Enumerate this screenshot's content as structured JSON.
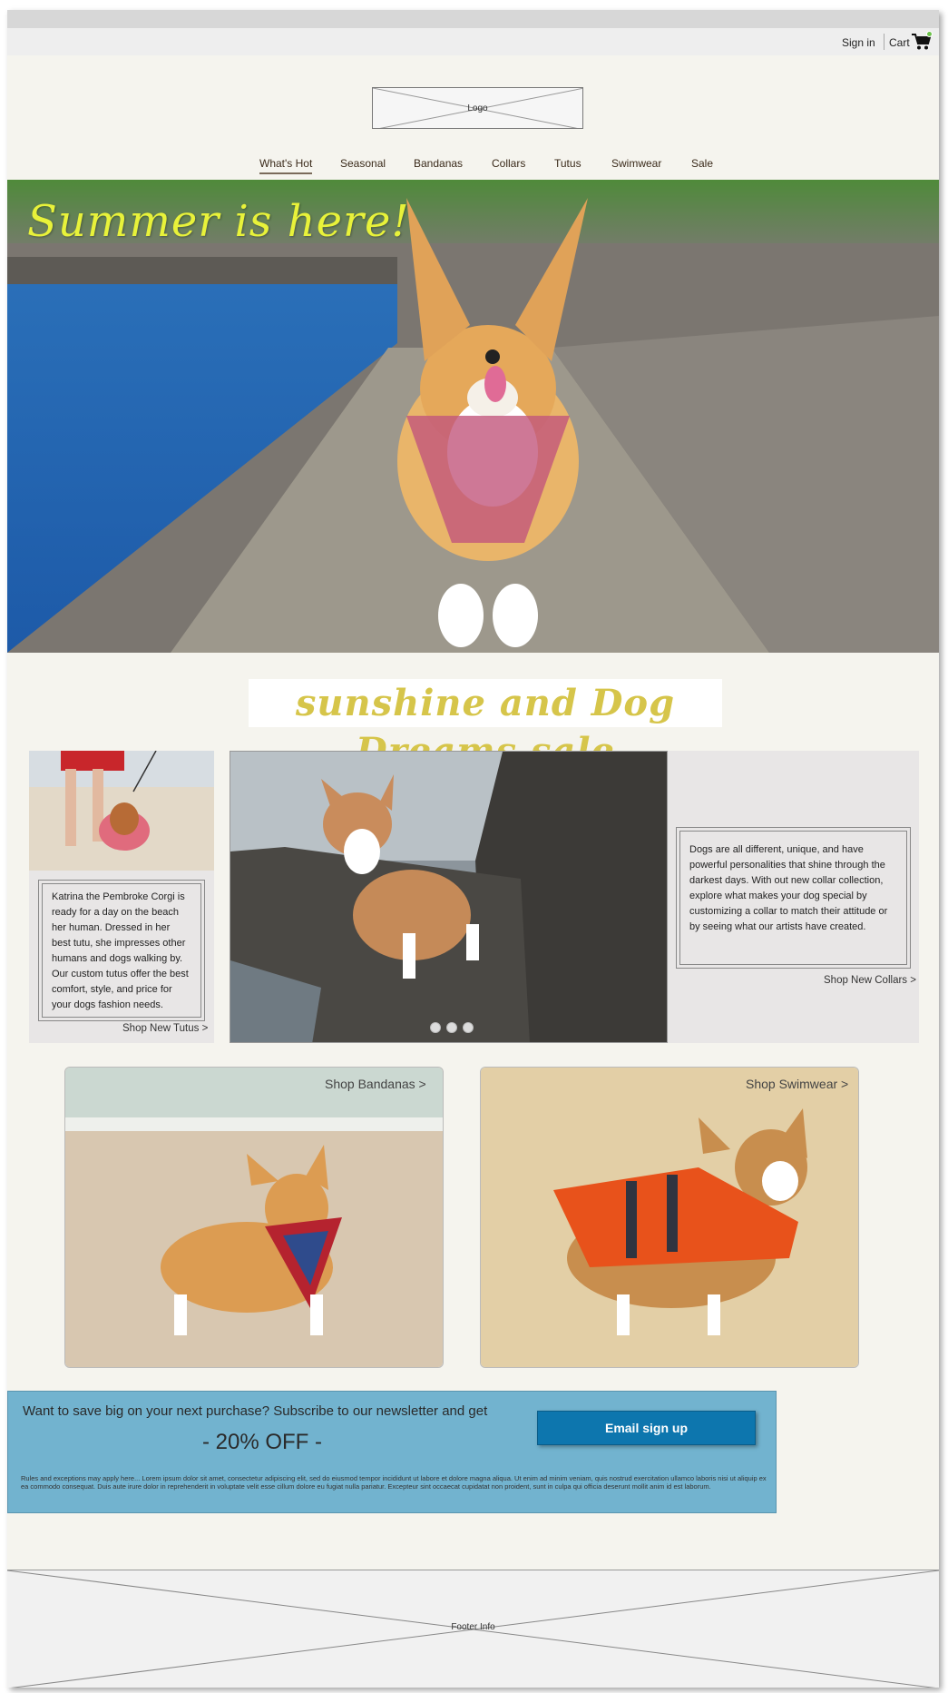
{
  "utility": {
    "signin": "Sign in",
    "cart": "Cart"
  },
  "logo": {
    "label": "Logo"
  },
  "nav": [
    {
      "label": "What's Hot",
      "active": true
    },
    {
      "label": "Seasonal"
    },
    {
      "label": "Bandanas"
    },
    {
      "label": "Collars"
    },
    {
      "label": "Tutus"
    },
    {
      "label": "Swimwear"
    },
    {
      "label": "Sale"
    }
  ],
  "hero": {
    "title": "Summer is here!"
  },
  "sale_banner": {
    "title": "sunshine and Dog Dreams sale"
  },
  "tutu_card": {
    "text": "Katrina the Pembroke Corgi is ready for a day on the beach her human. Dressed in her best tutu, she impresses other humans and dogs walking by. Our custom tutus offer the best comfort, style, and price for your dogs fashion needs.",
    "link": "Shop New Tutus >"
  },
  "carousel": {
    "dot_count": 3
  },
  "collar_card": {
    "text": "Dogs are all different, unique, and have powerful personalities that shine through the darkest days. With out new collar collection, explore what makes your dog special by customizing a collar to match their attitude or by seeing what our artists have created.",
    "link": "Shop New Collars >"
  },
  "promos": {
    "bandanas": {
      "link": "Shop Bandanas >"
    },
    "swimwear": {
      "link": "Shop Swimwear >"
    }
  },
  "newsletter": {
    "text": "Want to save big on your next purchase? Subscribe to our newsletter and get",
    "discount": "- 20% OFF -",
    "button": "Email sign up",
    "fine_print": "Rules and exceptions may apply here... Lorem ipsum dolor sit amet, consectetur adipiscing elit, sed do eiusmod tempor incididunt ut labore et dolore magna aliqua. Ut enim ad minim veniam, quis nostrud exercitation ullamco laboris nisi ut aliquip ex ea commodo consequat. Duis aute irure dolor in reprehenderit in voluptate velit esse cillum dolore eu fugiat nulla pariatur. Excepteur sint occaecat cupidatat non proident, sunt in culpa qui officia deserunt mollit anim id est laborum."
  },
  "footer": {
    "label": "Footer Info"
  },
  "colors": {
    "page_bg": "#f5f4ee",
    "newsletter_bg": "#72b3cf",
    "button": "#0d76ae",
    "hero_title": "#e8f23a",
    "sale_title": "#d6c54a"
  }
}
